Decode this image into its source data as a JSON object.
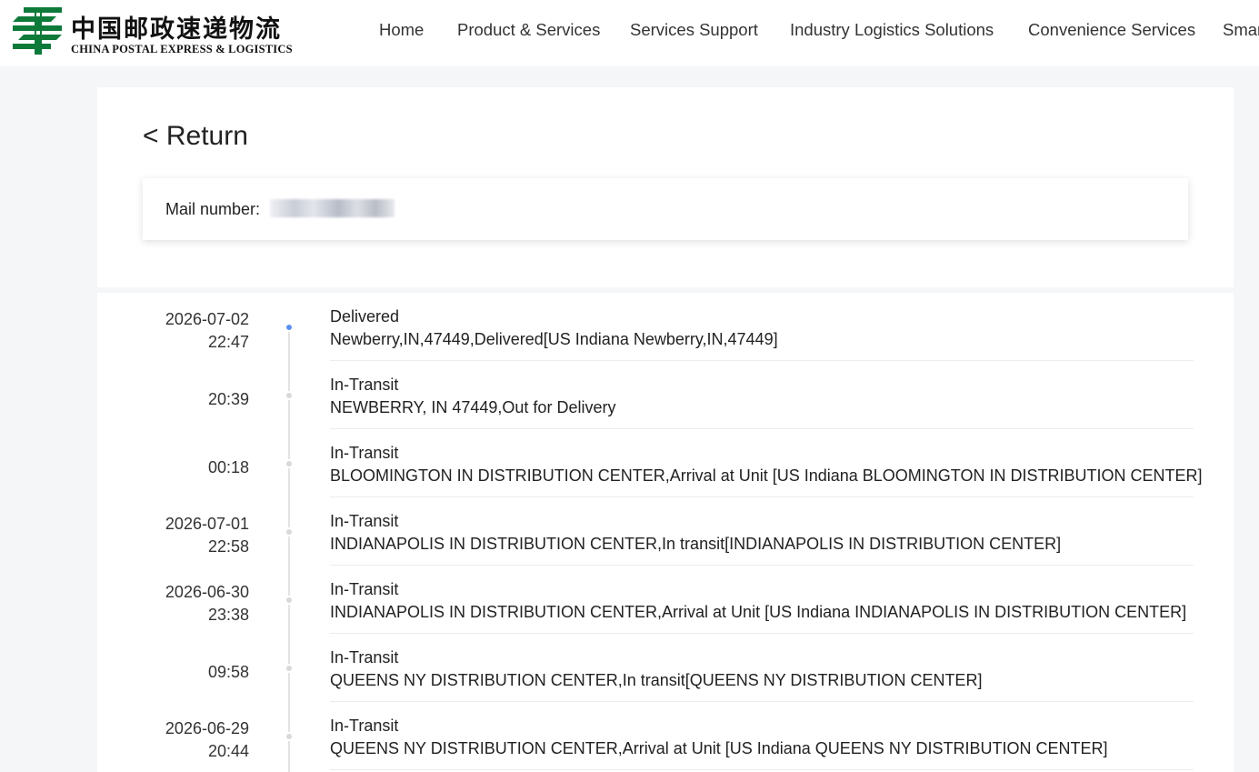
{
  "header": {
    "logo_cn": "中国邮政速递物流",
    "logo_en": "CHINA POSTAL EXPRESS & LOGISTICS",
    "logo_icon": "china-post-logo-icon",
    "brand_color": "#0e7a3a",
    "nav": [
      {
        "label": "Home"
      },
      {
        "label": "Product & Services"
      },
      {
        "label": "Services Support"
      },
      {
        "label": "Industry Logistics Solutions"
      },
      {
        "label": "Convenience Services"
      },
      {
        "label": "Smar"
      }
    ]
  },
  "page": {
    "return_label": "< Return",
    "mail_label": "Mail number:",
    "mail_value_redacted": true
  },
  "timeline": {
    "active_color": "#5b8ff0",
    "events": [
      {
        "date": "2026-07-02",
        "time": "22:47",
        "status": "Delivered",
        "detail": "Newberry,IN,47449,Delivered[US Indiana Newberry,IN,47449]",
        "active": true
      },
      {
        "date": "",
        "time": "20:39",
        "status": "In-Transit",
        "detail": "NEWBERRY, IN 47449,Out for Delivery",
        "active": false
      },
      {
        "date": "",
        "time": "00:18",
        "status": "In-Transit",
        "detail": "BLOOMINGTON IN DISTRIBUTION CENTER,Arrival at Unit [US Indiana BLOOMINGTON IN DISTRIBUTION CENTER]",
        "active": false
      },
      {
        "date": "2026-07-01",
        "time": "22:58",
        "status": "In-Transit",
        "detail": "INDIANAPOLIS IN DISTRIBUTION CENTER,In transit[INDIANAPOLIS IN DISTRIBUTION CENTER]",
        "active": false
      },
      {
        "date": "2026-06-30",
        "time": "23:38",
        "status": "In-Transit",
        "detail": "INDIANAPOLIS IN DISTRIBUTION CENTER,Arrival at Unit [US Indiana INDIANAPOLIS IN DISTRIBUTION CENTER]",
        "active": false
      },
      {
        "date": "",
        "time": "09:58",
        "status": "In-Transit",
        "detail": "QUEENS NY DISTRIBUTION CENTER,In transit[QUEENS NY DISTRIBUTION CENTER]",
        "active": false
      },
      {
        "date": "2026-06-29",
        "time": "20:44",
        "status": "In-Transit",
        "detail": "QUEENS NY DISTRIBUTION CENTER,Arrival at Unit [US Indiana QUEENS NY DISTRIBUTION CENTER]",
        "active": false
      }
    ]
  }
}
